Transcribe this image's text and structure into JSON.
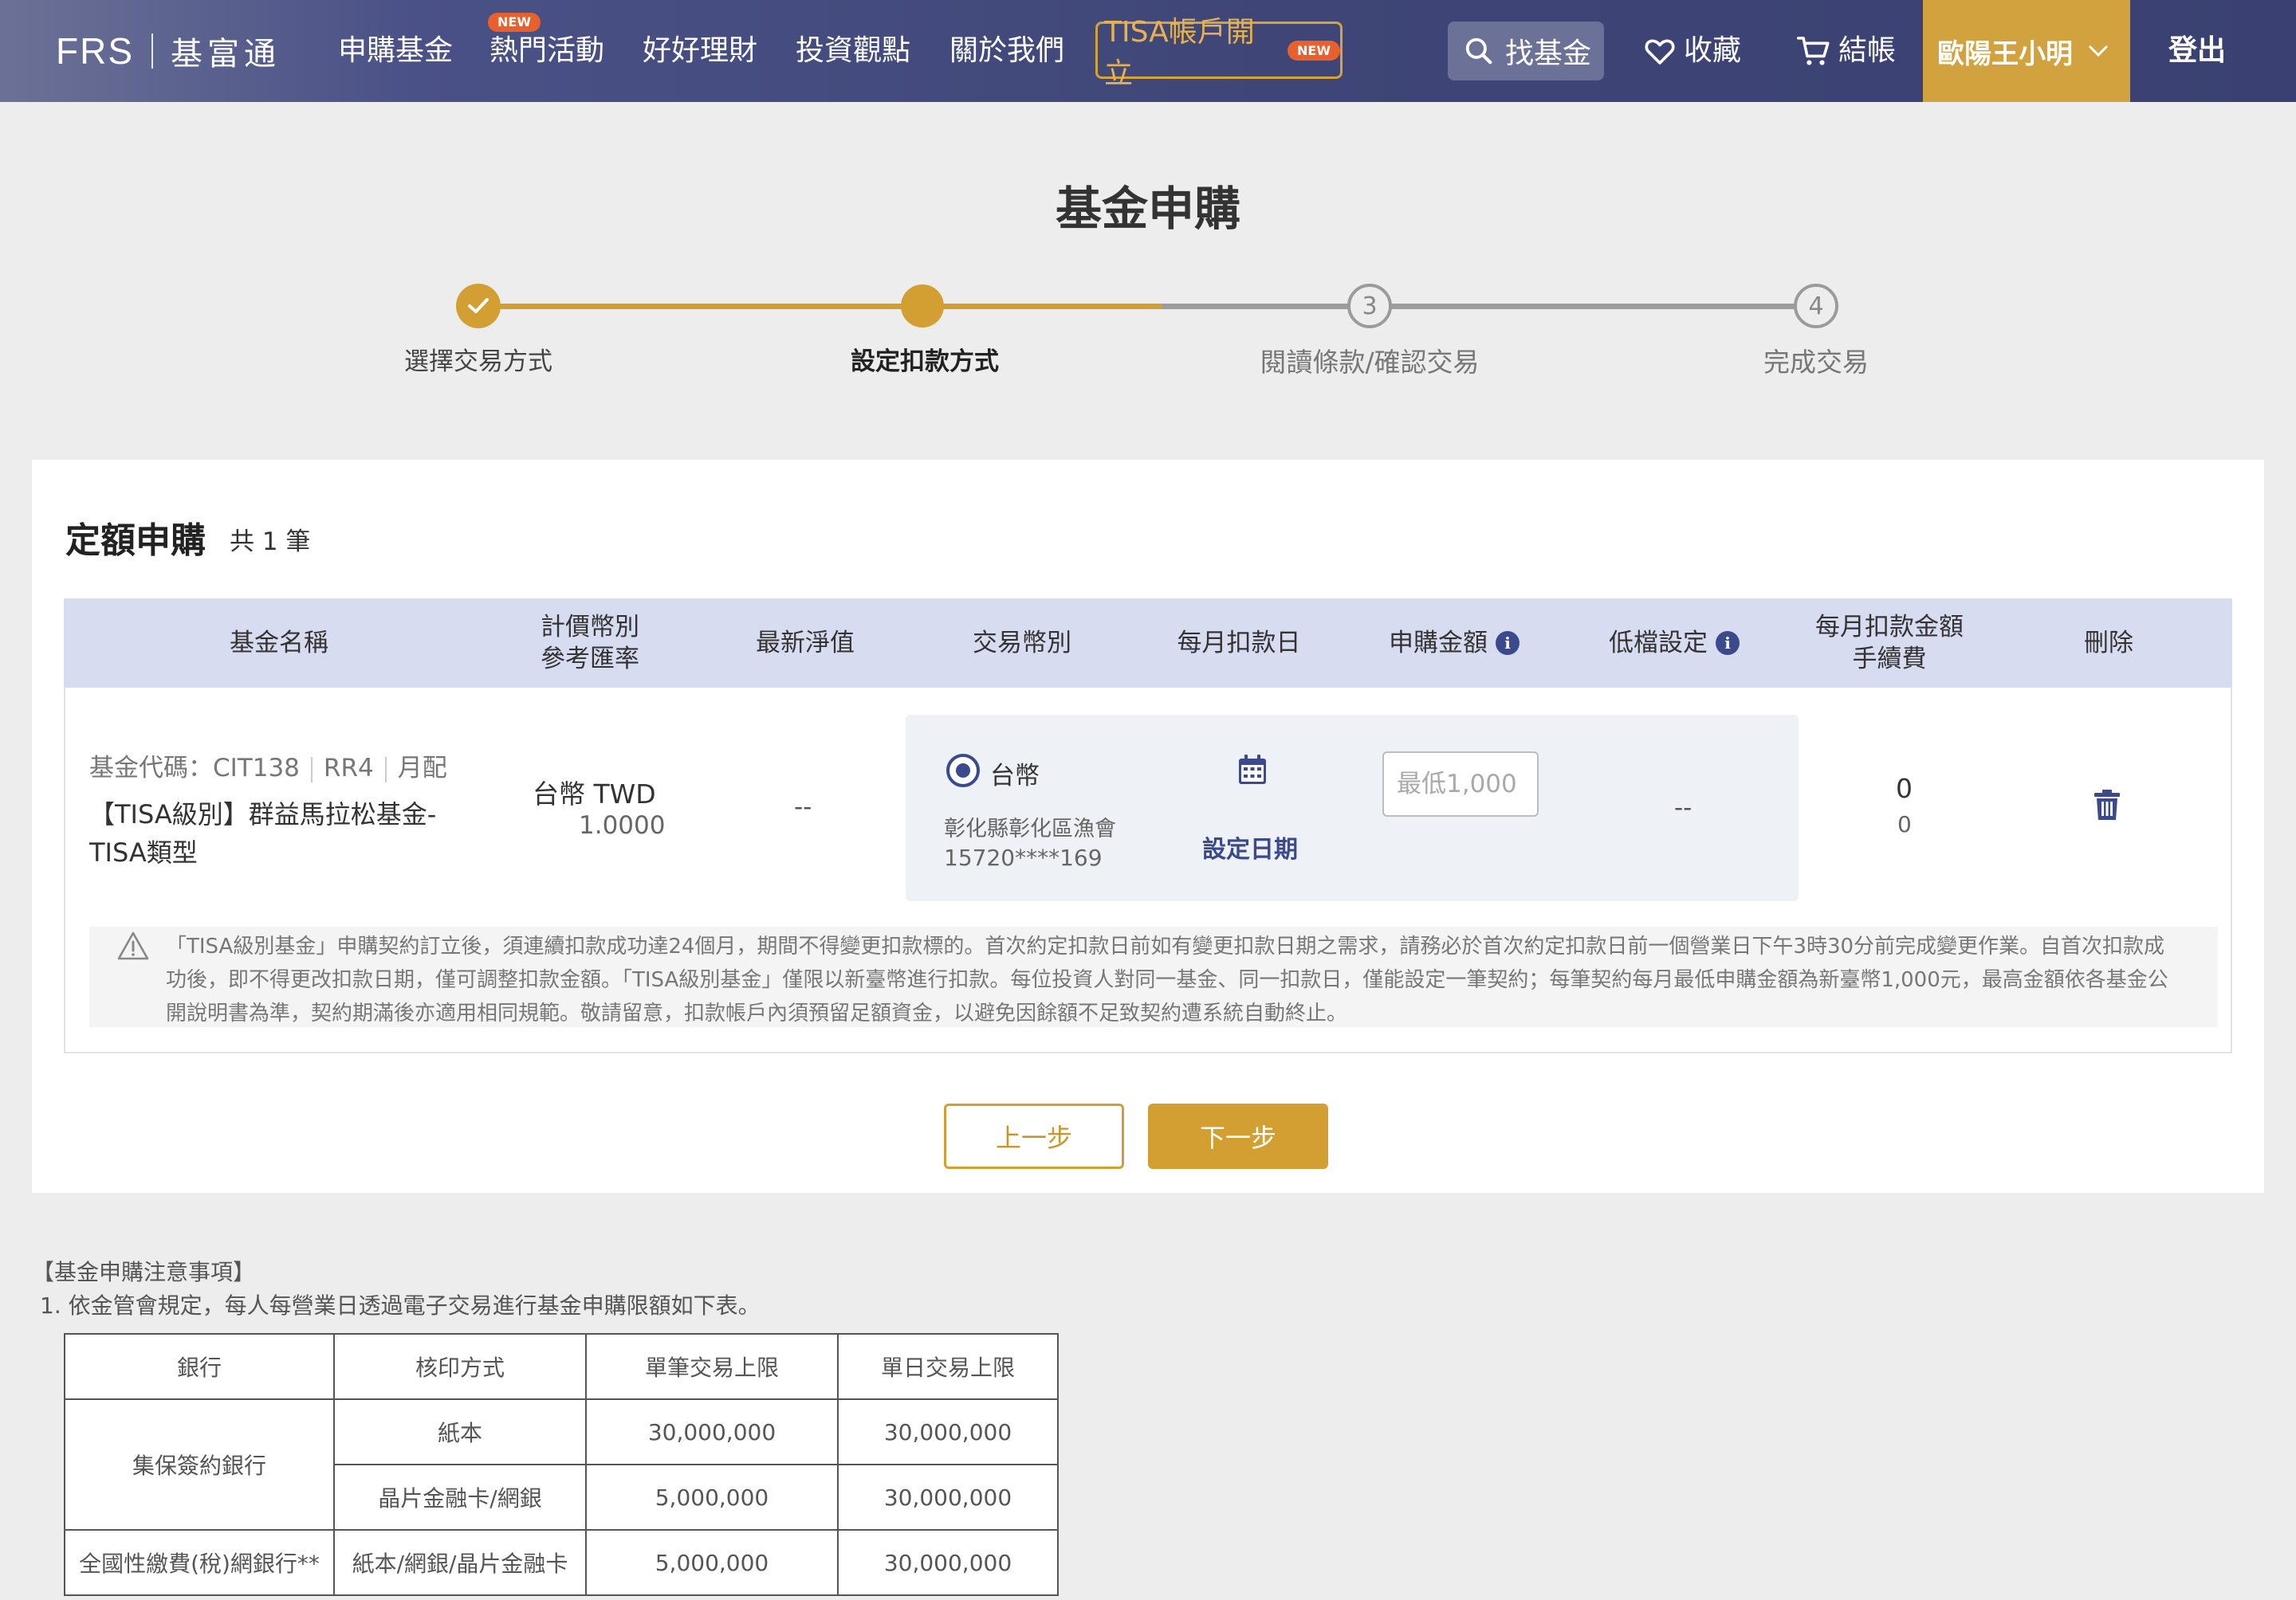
{
  "header": {
    "logo_mark": "FRS",
    "logo_text": "基富通",
    "nav": [
      "申購基金",
      "熱門活動",
      "好好理財",
      "投資觀點",
      "關於我們"
    ],
    "hot_badge": "NEW",
    "tisa_label": "TISA帳戶開立",
    "tisa_badge": "NEW",
    "search_label": "找基金",
    "favorites_label": "收藏",
    "checkout_label": "結帳",
    "user_name": "歐陽王小明",
    "logout_label": "登出"
  },
  "page_title": "基金申購",
  "steps": [
    {
      "label": "選擇交易方式",
      "state": "done"
    },
    {
      "label": "設定扣款方式",
      "state": "active"
    },
    {
      "label": "閱讀條款/確認交易",
      "state": "todo",
      "num": "3"
    },
    {
      "label": "完成交易",
      "state": "todo",
      "num": "4"
    }
  ],
  "section": {
    "title": "定額申購",
    "count": "共 1 筆"
  },
  "table": {
    "headers": {
      "fund_name": "基金名稱",
      "currency_1": "計價幣別",
      "currency_2": "參考匯率",
      "nav": "最新淨值",
      "trade_currency": "交易幣別",
      "debit_day": "每月扣款日",
      "amount": "申購金額",
      "low_setting": "低檔設定",
      "monthly_1": "每月扣款金額",
      "monthly_2": "手續費",
      "delete": "刪除"
    },
    "row": {
      "code": "基金代碼：CIT138",
      "risk": "RR4",
      "dividend": "月配",
      "name": "【TISA級別】群益馬拉松基金-TISA類型",
      "currency": "台幣 TWD",
      "rate": "1.0000",
      "nav": "--",
      "trade_currency": "台幣",
      "bank": "彰化縣彰化區漁會",
      "account": "15720****169",
      "set_date": "設定日期",
      "amount_placeholder": "最低1,000",
      "low_setting": "--",
      "monthly_amount": "0",
      "fee": "0"
    }
  },
  "notice": "「TISA級別基金」申購契約訂立後，須連續扣款成功達24個月，期間不得變更扣款標的。首次約定扣款日前如有變更扣款日期之需求，請務必於首次約定扣款日前一個營業日下午3時30分前完成變更作業。自首次扣款成功後，即不得更改扣款日期，僅可調整扣款金額。「TISA級別基金」僅限以新臺幣進行扣款。每位投資人對同一基金、同一扣款日，僅能設定一筆契約；每筆契約每月最低申購金額為新臺幣1,000元，最高金額依各基金公開說明書為準，契約期滿後亦適用相同規範。敬請留意，扣款帳戶內須預留足額資金，以避免因餘額不足致契約遭系統自動終止。",
  "buttons": {
    "prev": "上一步",
    "next": "下一步"
  },
  "notes": {
    "title": "【基金申購注意事項】",
    "line1": "1. 依金管會規定，每人每營業日透過電子交易進行基金申購限額如下表。",
    "table_headers": [
      "銀行",
      "核印方式",
      "單筆交易上限",
      "單日交易上限"
    ],
    "group1": "集保簽約銀行",
    "rows": [
      {
        "method": "紙本",
        "single": "30,000,000",
        "daily": "30,000,000"
      },
      {
        "method": "晶片金融卡/網銀",
        "single": "5,000,000",
        "daily": "30,000,000"
      }
    ],
    "row3": {
      "bank": "全國性繳費(稅)網銀行**",
      "method": "紙本/網銀/晶片金融卡",
      "single": "5,000,000",
      "daily": "30,000,000"
    }
  },
  "colors": {
    "brand_gold": "#d39f33",
    "navy": "#3b4a8c",
    "header": "#3f4677"
  }
}
